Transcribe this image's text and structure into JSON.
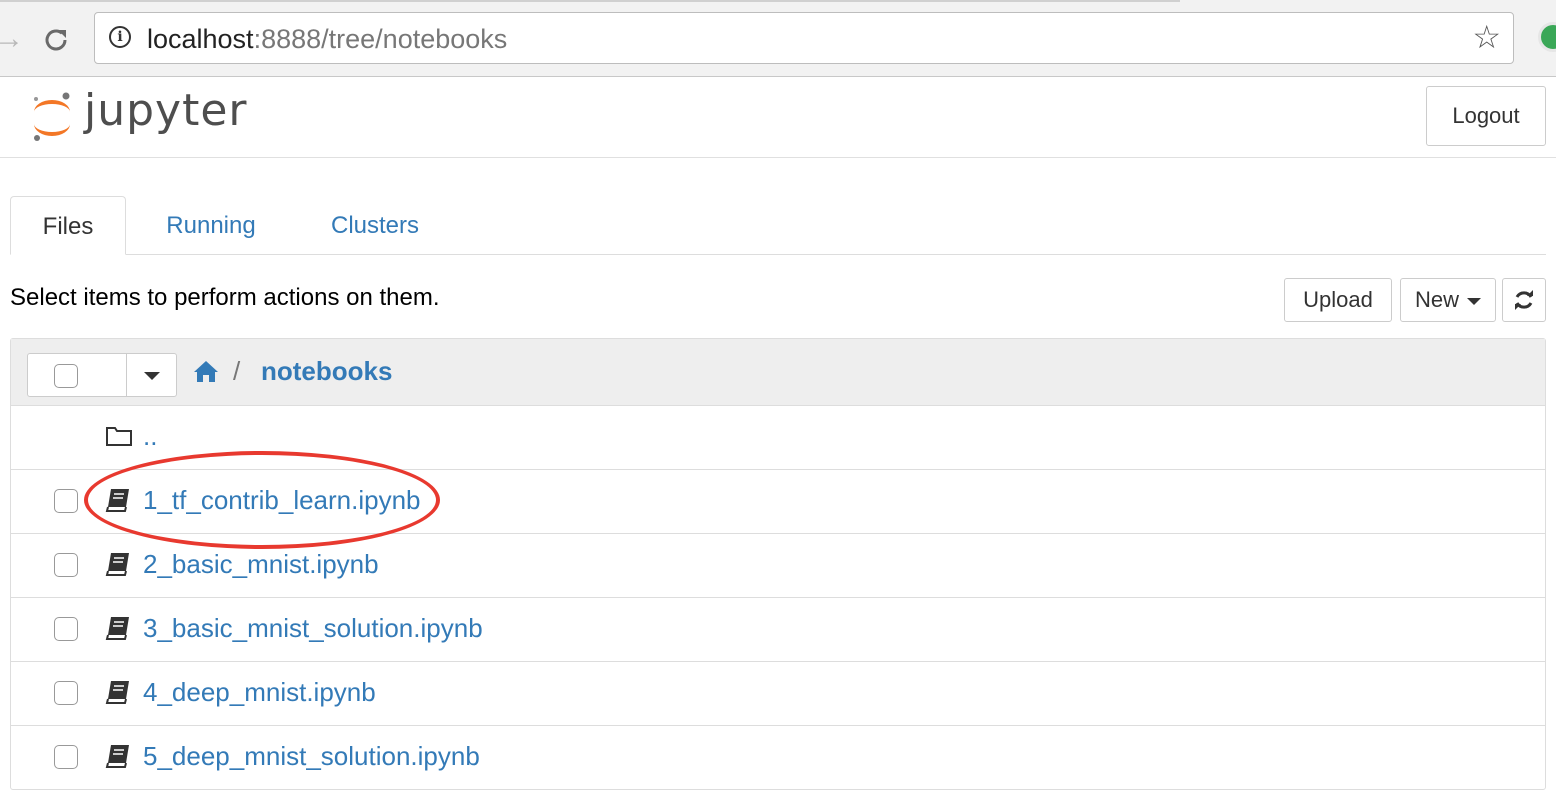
{
  "browser": {
    "url_host": "localhost",
    "url_rest": ":8888/tree/notebooks",
    "icons": {
      "forward": "forward-arrow-icon",
      "reload": "reload-icon",
      "info": "info-icon",
      "bookmark": "star-icon",
      "extension": "extension-icon"
    }
  },
  "header": {
    "logo_text": "jupyter",
    "logout_label": "Logout"
  },
  "tabs": [
    {
      "label": "Files",
      "active": true
    },
    {
      "label": "Running",
      "active": false
    },
    {
      "label": "Clusters",
      "active": false
    }
  ],
  "toolbar": {
    "hint": "Select items to perform actions on them.",
    "upload_label": "Upload",
    "new_label": "New",
    "refresh_icon": "refresh-icon"
  },
  "breadcrumb": {
    "separator": "/",
    "current": "notebooks"
  },
  "files": [
    {
      "name": "..",
      "type": "folder"
    },
    {
      "name": "1_tf_contrib_learn.ipynb",
      "type": "notebook",
      "highlighted": true
    },
    {
      "name": "2_basic_mnist.ipynb",
      "type": "notebook"
    },
    {
      "name": "3_basic_mnist_solution.ipynb",
      "type": "notebook"
    },
    {
      "name": "4_deep_mnist.ipynb",
      "type": "notebook"
    },
    {
      "name": "5_deep_mnist_solution.ipynb",
      "type": "notebook"
    }
  ],
  "colors": {
    "link": "#337ab7",
    "annotation": "#e8392f",
    "jupyter_orange": "#f37726"
  }
}
